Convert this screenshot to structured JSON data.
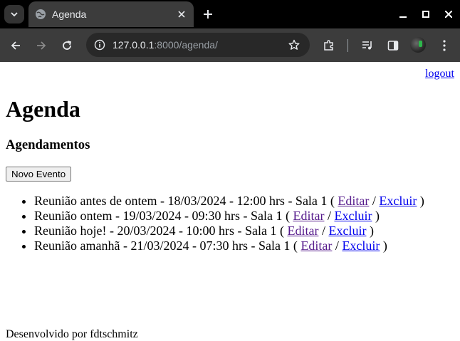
{
  "browser": {
    "tab_title": "Agenda",
    "url_host": "127.0.0.1",
    "url_rest": ":8000/agenda/"
  },
  "page": {
    "logout": "logout",
    "title": "Agenda",
    "subtitle": "Agendamentos",
    "new_event_button": "Novo Evento",
    "events": [
      {
        "text": "Reunião antes de ontem - 18/03/2024 - 12:00 hrs - Sala 1 (",
        "edit": "Editar",
        "sep": "/",
        "delete": "Excluir",
        "close": ")"
      },
      {
        "text": "Reunião ontem - 19/03/2024 - 09:30 hrs - Sala 1 (",
        "edit": "Editar",
        "sep": "/",
        "delete": "Excluir",
        "close": ")"
      },
      {
        "text": "Reunião hoje! - 20/03/2024 - 10:00 hrs - Sala 1 (",
        "edit": "Editar",
        "sep": "/",
        "delete": "Excluir",
        "close": ")"
      },
      {
        "text": "Reunião amanhã - 21/03/2024 - 07:30 hrs - Sala 1 (",
        "edit": "Editar",
        "sep": "/",
        "delete": "Excluir",
        "close": ")"
      }
    ],
    "footer": "Desenvolvido por fdtschmitz"
  },
  "colors": {
    "chrome_dark": "#000000",
    "toolbar": "#3c3c3c",
    "link": "#0000ee",
    "visited_link": "#551a8b"
  }
}
